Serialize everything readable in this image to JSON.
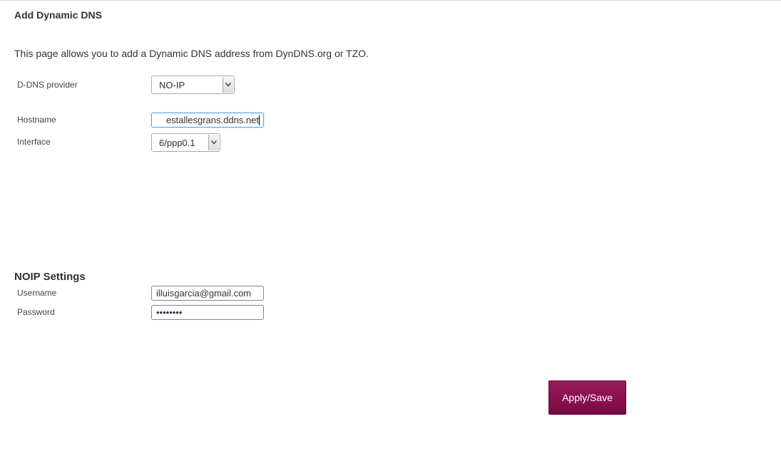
{
  "page": {
    "title": "Add Dynamic DNS",
    "description": "This page allows you to add a Dynamic DNS address from DynDNS.org or TZO."
  },
  "form": {
    "provider": {
      "label": "D-DNS provider",
      "value": "NO-IP"
    },
    "hostname": {
      "label": "Hostname",
      "value": "estallesgrans.ddns.net"
    },
    "interface": {
      "label": "Interface",
      "value": "6/ppp0.1"
    }
  },
  "noip": {
    "title": "NOIP Settings",
    "username": {
      "label": "Username",
      "value": "illuisgarcia@gmail.com"
    },
    "password": {
      "label": "Password",
      "value": "••••••••"
    }
  },
  "actions": {
    "apply_label": "Apply/Save"
  },
  "colors": {
    "accent": "#8b1250",
    "focus_border": "#5ea4e0"
  },
  "icons": {
    "dropdown": "chevron-down-icon"
  }
}
